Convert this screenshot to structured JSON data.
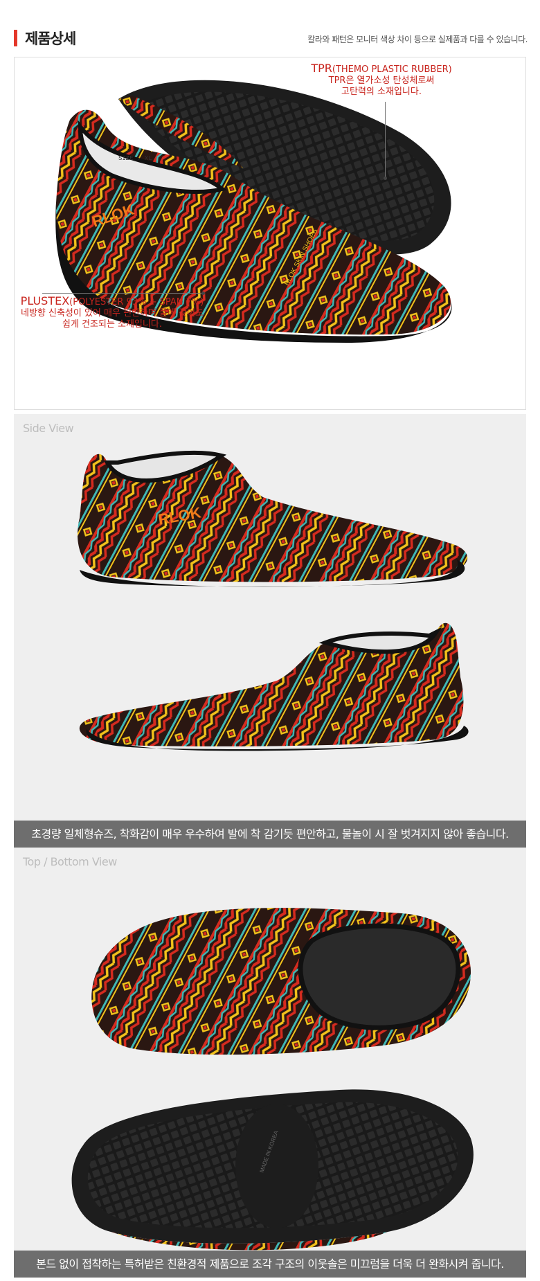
{
  "header": {
    "title": "제품상세",
    "note": "칼라와 패턴은 모니터 색상 차이 등으로 실제품과 다를 수 있습니다."
  },
  "callouts": {
    "tpr": {
      "title": "TPR",
      "title_detail": "(THEMO PLASTIC RUBBER)",
      "line1": "TPR은 열가소성 탄성체로써",
      "line2": "고탄력의 소재입니다."
    },
    "plustex": {
      "title": "PLUSTEX",
      "title_detail": "(POLYESTER 93% + SPAN 7%)",
      "line1": "네방향 신축성이 있어 매우 편안하며 물에 젖어도",
      "line2": "쉽게 건조되는 소재입니다."
    }
  },
  "shoe": {
    "brand": "RLOK",
    "side_print": "RLOK SKIN SHOES",
    "size": "SIZE : XL",
    "sole_print": "MADE IN KOREA"
  },
  "side_view": {
    "label": "Side View",
    "caption": "초경량 일체형슈즈, 착화감이 매우 우수하여 발에 착 감기듯 편안하고, 물놀이 시 잘 벗겨지지 않아 좋습니다."
  },
  "top_view": {
    "label": "Top / Bottom View",
    "caption": "본드 없이 접착하는 특허받은 친환경적 제품으로 조각 구조의 이웃솔은 미끄럼을 더욱 더 완화시켜 줍니다."
  },
  "colors": {
    "accent": "#e4372a",
    "caption_bg": "#6e6e6e",
    "shoe_red": "#d62b1f",
    "shoe_yellow": "#f2c21b",
    "shoe_teal": "#3fb7b5",
    "shoe_dark": "#2a1712",
    "sole": "#1d1d1d"
  }
}
